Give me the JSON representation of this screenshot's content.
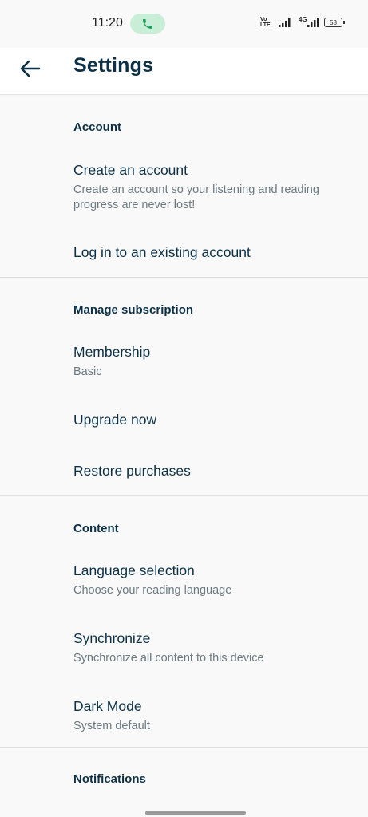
{
  "status_bar": {
    "time": "11:20",
    "volte": "Vo LTE",
    "network": "4G",
    "battery": "58"
  },
  "header": {
    "title": "Settings"
  },
  "sections": {
    "account": {
      "header": "Account",
      "create": {
        "title": "Create an account",
        "subtitle": "Create an account so your listening and reading progress are never lost!"
      },
      "login": {
        "title": "Log in to an existing account"
      }
    },
    "subscription": {
      "header": "Manage subscription",
      "membership": {
        "title": "Membership",
        "subtitle": "Basic"
      },
      "upgrade": {
        "title": "Upgrade now"
      },
      "restore": {
        "title": "Restore purchases"
      }
    },
    "content": {
      "header": "Content",
      "language": {
        "title": "Language selection",
        "subtitle": "Choose your reading language"
      },
      "sync": {
        "title": "Synchronize",
        "subtitle": "Synchronize all content to this device"
      },
      "dark_mode": {
        "title": "Dark Mode",
        "subtitle": "System default"
      }
    },
    "notifications": {
      "header": "Notifications"
    }
  },
  "colors": {
    "background": "#f9f9f9",
    "text_primary": "#0c3146",
    "text_secondary": "#6b7a80",
    "call_pill": "#c9eed8",
    "call_icon": "#1e9e5a"
  },
  "icons": {
    "back": "arrow-left-icon",
    "call": "phone-icon",
    "signal": "signal-icon",
    "battery": "battery-icon"
  }
}
